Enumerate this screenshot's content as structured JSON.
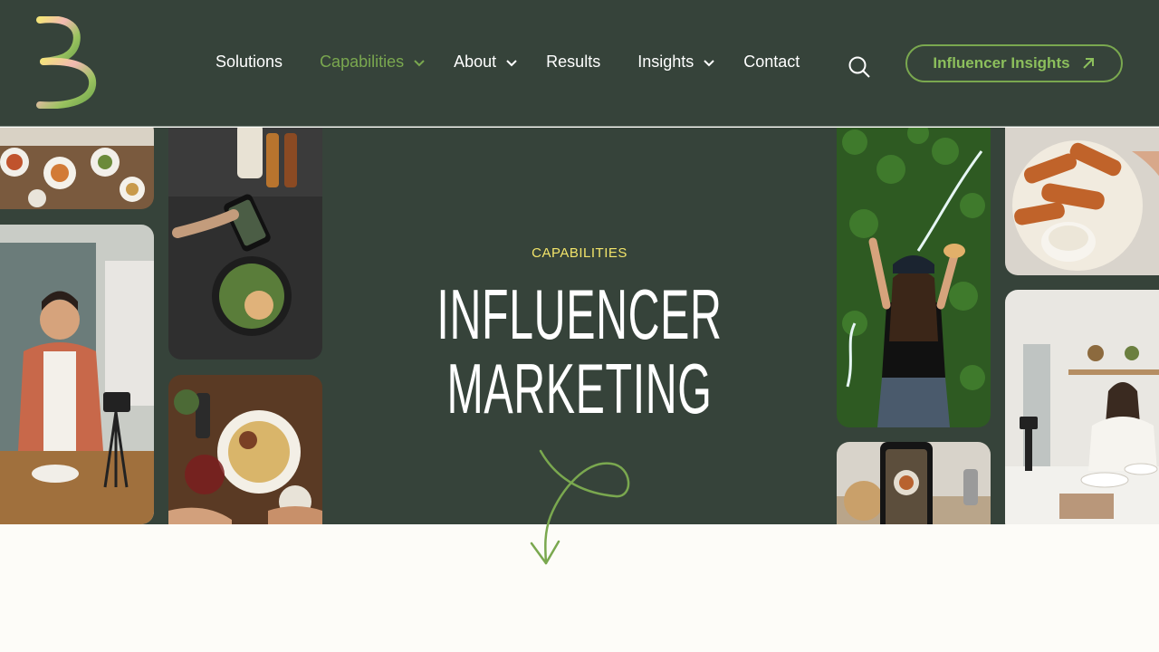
{
  "brand": {
    "logo_letter": "B",
    "accent": "#7aa84f",
    "header_bg": "#36433a",
    "eyebrow_color": "#f2e46a"
  },
  "nav": {
    "items": [
      {
        "label": "Solutions",
        "has_dropdown": false,
        "active": false
      },
      {
        "label": "Capabilities",
        "has_dropdown": true,
        "active": true
      },
      {
        "label": "About",
        "has_dropdown": true,
        "active": false
      },
      {
        "label": "Results",
        "has_dropdown": false,
        "active": false
      },
      {
        "label": "Insights",
        "has_dropdown": true,
        "active": false
      },
      {
        "label": "Contact",
        "has_dropdown": false,
        "active": false
      }
    ],
    "search_icon": "search-icon",
    "cta_label": "Influencer Insights",
    "cta_icon": "arrow-up-right-icon"
  },
  "hero": {
    "eyebrow": "CAPABILITIES",
    "title_line1": "INFLUENCER",
    "title_line2": "MARKETING",
    "scroll_icon": "squiggle-arrow-down-icon"
  }
}
